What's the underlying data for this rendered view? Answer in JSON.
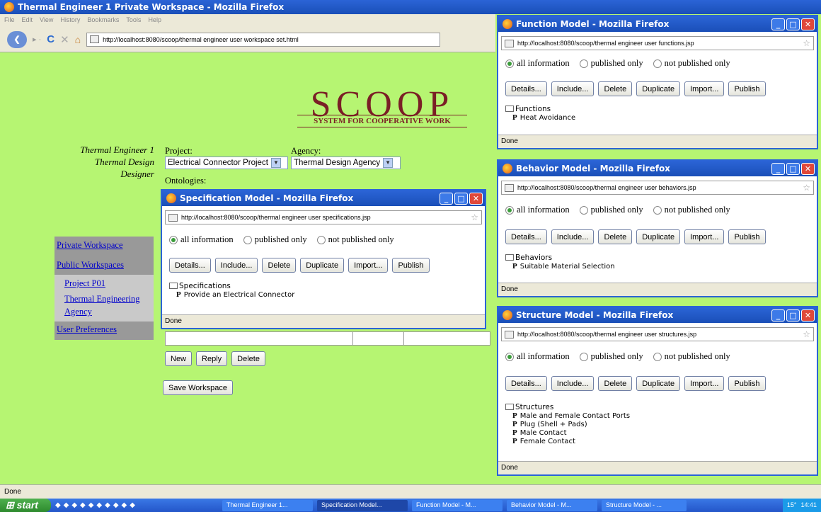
{
  "main": {
    "title": "Thermal Engineer 1 Private Workspace - Mozilla Firefox",
    "menu": [
      "File",
      "Edit",
      "View",
      "History",
      "Bookmarks",
      "Tools",
      "Help"
    ],
    "url": "http://localhost:8080/scoop/thermal engineer user workspace set.html",
    "status": "Done"
  },
  "brand": {
    "logo": "SCOOP",
    "tagline": "SYSTEM FOR COOPERATIVE WORK"
  },
  "user": {
    "name": "Thermal Engineer 1",
    "org": "Thermal Design",
    "role": "Designer"
  },
  "form": {
    "project_label": "Project:",
    "project_value": "Electrical Connector Project",
    "agency_label": "Agency:",
    "agency_value": "Thermal Design Agency",
    "ontologies_label": "Ontologies:"
  },
  "nav": {
    "private": "Private Workspace",
    "public": "Public Workspaces",
    "project": "Project P01",
    "agency": "Thermal Engineering Agency",
    "prefs": "User Preferences"
  },
  "msg": {
    "new": "New",
    "reply": "Reply",
    "delete": "Delete",
    "save": "Save Workspace"
  },
  "filters": {
    "all": "all information",
    "pub": "published only",
    "notpub": "not published only"
  },
  "buttons": {
    "details": "Details...",
    "include": "Include...",
    "delete": "Delete",
    "duplicate": "Duplicate",
    "import": "Import...",
    "publish": "Publish"
  },
  "spec": {
    "title": "Specification Model - Mozilla Firefox",
    "url": "http://localhost:8080/scoop/thermal engineer user specifications.jsp",
    "root": "Specifications",
    "items": [
      "Provide an Electrical Connector"
    ],
    "status": "Done"
  },
  "func": {
    "title": "Function Model - Mozilla Firefox",
    "url": "http://localhost:8080/scoop/thermal engineer user functions.jsp",
    "root": "Functions",
    "items": [
      "Heat Avoidance"
    ],
    "status": "Done"
  },
  "beh": {
    "title": "Behavior Model - Mozilla Firefox",
    "url": "http://localhost:8080/scoop/thermal engineer user behaviors.jsp",
    "root": "Behaviors",
    "items": [
      "Suitable Material Selection"
    ],
    "status": "Done"
  },
  "str": {
    "title": "Structure Model - Mozilla Firefox",
    "url": "http://localhost:8080/scoop/thermal engineer user structures.jsp",
    "root": "Structures",
    "items": [
      "Male and Female Contact Ports",
      "Plug (Shell + Pads)",
      "Male Contact",
      "Female Contact"
    ],
    "status": "Done"
  },
  "taskbar": {
    "start": "start",
    "tasks": [
      "Thermal Engineer 1...",
      "Specification Model...",
      "Function Model - M...",
      "Behavior Model - M...",
      "Structure Model - ..."
    ],
    "temp": "15°",
    "clock": "14:41"
  },
  "leaf_marker": "P"
}
